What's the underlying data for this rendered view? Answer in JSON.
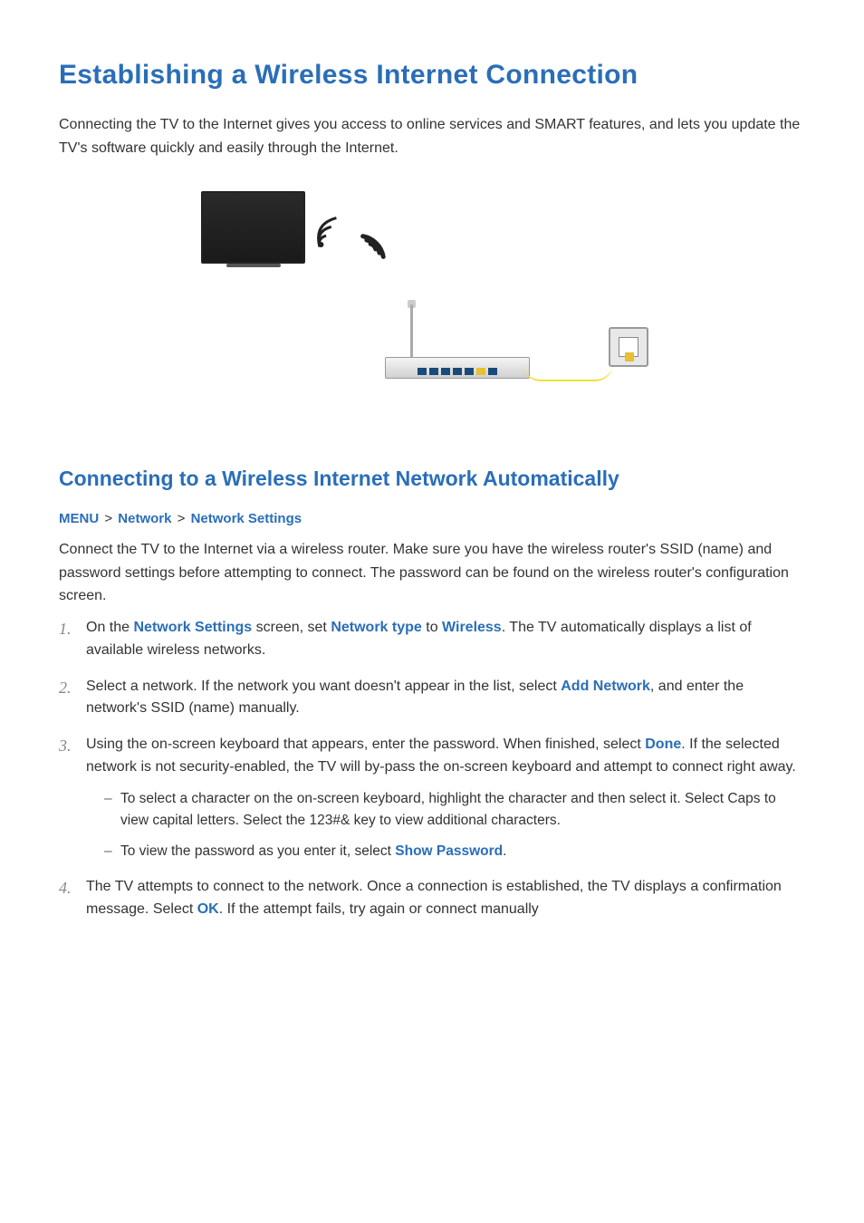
{
  "title": "Establishing a Wireless Internet Connection",
  "intro": "Connecting the TV to the Internet gives you access to online services and SMART features, and lets you update the TV's software quickly and easily through the Internet.",
  "section": {
    "title": "Connecting to a Wireless Internet Network Automatically",
    "breadcrumb": {
      "menu": "MENU",
      "network": "Network",
      "settings": "Network Settings",
      "sep": ">"
    },
    "text": "Connect the TV to the Internet via a wireless router. Make sure you have the wireless router's SSID (name) and password settings before attempting to connect. The password can be found on the wireless router's configuration screen.",
    "steps": [
      {
        "pre1": "On the ",
        "hl1": "Network Settings",
        "mid1": " screen, set ",
        "hl2": "Network type",
        "mid2": " to ",
        "hl3": "Wireless",
        "post": ". The TV automatically displays a list of available wireless networks."
      },
      {
        "pre1": "Select a network. If the network you want doesn't appear in the list, select ",
        "hl1": "Add Network",
        "post": ", and enter the network's SSID (name) manually."
      },
      {
        "pre1": "Using the on-screen keyboard that appears, enter the password. When finished, select ",
        "hl1": "Done",
        "post": ". If the selected network is not security-enabled, the TV will by-pass the on-screen keyboard and attempt to connect right away.",
        "sub": [
          {
            "text": "To select a character on the on-screen keyboard, highlight the character and then select it. Select Caps to view capital letters. Select the 123#& key to view additional characters."
          },
          {
            "pre": "To view the password as you enter it, select ",
            "hl": "Show Password",
            "post": "."
          }
        ]
      },
      {
        "pre1": "The TV attempts to connect to the network. Once a connection is established, the TV displays a confirmation message. Select ",
        "hl1": "OK",
        "post": ". If the attempt fails, try again or connect manually"
      }
    ]
  },
  "diagram": {
    "items": [
      "tv",
      "wifi-signal",
      "router",
      "cable",
      "wall-socket"
    ]
  }
}
